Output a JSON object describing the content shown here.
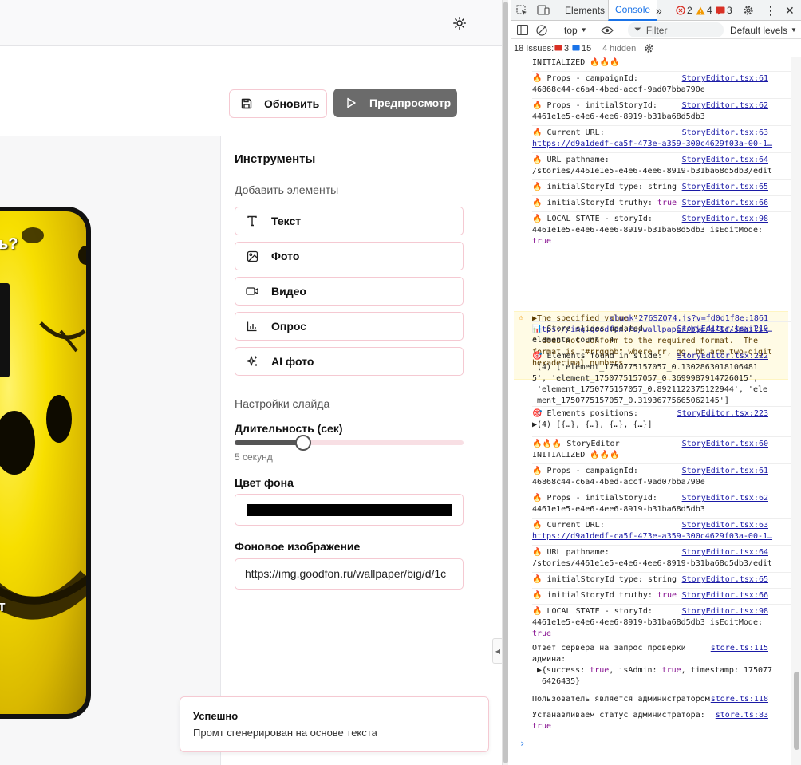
{
  "app": {
    "header": {
      "update_label": "Обновить",
      "preview_label": "Предпросмотр"
    },
    "slide_preview": {
      "text_top": "ь?",
      "text_bottom": "ст"
    },
    "tools": {
      "title": "Инструменты",
      "add_elements": "Добавить элементы",
      "items": [
        {
          "label": "Текст",
          "icon": "text-icon"
        },
        {
          "label": "Фото",
          "icon": "image-icon"
        },
        {
          "label": "Видео",
          "icon": "video-icon"
        },
        {
          "label": "Опрос",
          "icon": "chart-icon"
        },
        {
          "label": "AI фото",
          "icon": "sparkles-icon"
        }
      ],
      "slide_settings": "Настройки слайда",
      "duration_label": "Длительность (сек)",
      "duration_value": "5 секунд",
      "duration_fraction": 0.3,
      "bg_color_label": "Цвет фона",
      "bg_color_value": "#000000",
      "bg_image_label": "Фоновое изображение",
      "bg_image_value": "https://img.goodfon.ru/wallpaper/big/d/1c"
    },
    "toast": {
      "title": "Успешно",
      "message": "Промт сгенерирован на основе текста"
    }
  },
  "devtools": {
    "tabs": [
      "Elements",
      "Console"
    ],
    "active_tab": "Console",
    "error_count": "2",
    "warning_count": "4",
    "issue_badge_count": "3",
    "context": "top",
    "filter_placeholder": "Filter",
    "levels": "Default levels",
    "issues_label": "18 Issues:",
    "issues_errors": "3",
    "issues_info": "15",
    "hidden": "4 hidden",
    "logs": [
      {
        "text": "INITIALIZED 🔥🔥🔥",
        "src": ""
      },
      {
        "text": "🔥 Props - campaignId:\n46868c44-c6a4-4bed-accf-9ad07bba790e",
        "src": "StoryEditor.tsx:61"
      },
      {
        "text": "🔥 Props - initialStoryId:\n4461e1e5-e4e6-4ee6-8919-b31ba68d5db3",
        "src": "StoryEditor.tsx:62"
      },
      {
        "text": "🔥 Current URL:",
        "src": "StoryEditor.tsx:63",
        "link": "https://d9a1dedf-ca5f-473e-a359-300c4629f03a-00-1…"
      },
      {
        "text": "🔥 URL pathname:\n/stories/4461e1e5-e4e6-4ee6-8919-b31ba68d5db3/edit",
        "src": "StoryEditor.tsx:64"
      },
      {
        "text": "🔥 initialStoryId type: string",
        "src": "StoryEditor.tsx:65"
      },
      {
        "text": "🔥 initialStoryId truthy: true",
        "src": "StoryEditor.tsx:66"
      },
      {
        "text": "🔥 LOCAL STATE - storyId:\n4461e1e5-e4e6-4ee6-8919-b31ba68d5db3 isEditMode:\ntrue",
        "src": "StoryEditor.tsx:98"
      },
      {
        "text": "▶The specified",
        "src": "chunk-276SZO74.js?v=fd0d1f8e:1861",
        "link": "https://img.goodfon.ru/wallpaper/big/d/1c/smailik…",
        "cont": "\" does not conform to the required format.  The\nformat is \"#rrggbb\" where rr, gg, bb are two-digit\nhexadecimal numbers."
      },
      {
        "text": "📊 Store slides updated,\nelements count: 4",
        "src": "StoryEditor.tsx:219"
      },
      {
        "text": "🎯 Elements found in slide:\n (4) ['element_1750775157057_0.1302863018106481\n5', 'element_1750775157057_0.3699987914726015',\n 'element_1750775157057_0.8921122375122944', 'ele\n ment_1750775157057_0.31936775665062145']",
        "src": "StoryEditor.tsx:222"
      },
      {
        "text": "🎯 Elements positions:\n▶(4) [{…}, {…}, {…}, {…}]",
        "src": "StoryEditor.tsx:223"
      },
      {
        "text": "🔥🔥🔥 StoryEditor\nINITIALIZED 🔥🔥🔥",
        "src": "StoryEditor.tsx:60"
      },
      {
        "text": "🔥 Props - campaignId:\n46868c44-c6a4-4bed-accf-9ad07bba790e",
        "src": "StoryEditor.tsx:61"
      },
      {
        "text": "🔥 Props - initialStoryId:\n4461e1e5-e4e6-4ee6-8919-b31ba68d5db3",
        "src": "StoryEditor.tsx:62"
      },
      {
        "text": "🔥 Current URL:",
        "src": "StoryEditor.tsx:63",
        "link": "https://d9a1dedf-ca5f-473e-a359-300c4629f03a-00-1…"
      },
      {
        "text": "🔥 URL pathname:\n/stories/4461e1e5-e4e6-4ee6-8919-b31ba68d5db3/edit",
        "src": "StoryEditor.tsx:64"
      },
      {
        "text": "🔥 initialStoryId type: string",
        "src": "StoryEditor.tsx:65"
      },
      {
        "text": "🔥 initialStoryId truthy: true",
        "src": "StoryEditor.tsx:66"
      },
      {
        "text": "🔥 LOCAL STATE - storyId:\n4461e1e5-e4e6-4ee6-8919-b31ba68d5db3 isEditMode:\ntrue",
        "src": "StoryEditor.tsx:98"
      },
      {
        "text": "Ответ сервера на запрос проверки\nадмина:\n ▶{success: true, isAdmin: true, timestamp: 175077\n  6426435}",
        "src": "store.ts:115"
      },
      {
        "text": "Пользователь является администратором",
        "src": "store.ts:118"
      },
      {
        "text": "Устанавливаем статус администратора:\ntrue",
        "src": "store.ts:83"
      }
    ]
  }
}
